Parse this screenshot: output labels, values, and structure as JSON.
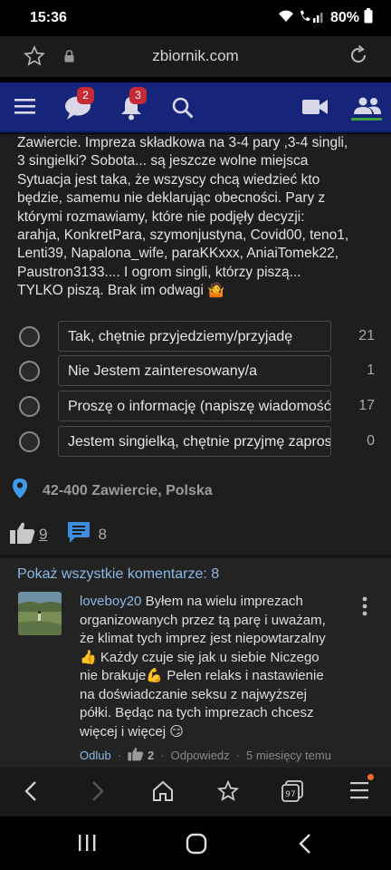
{
  "status_bar": {
    "time": "15:36",
    "battery": "80%"
  },
  "browser": {
    "url": "zbiornik.com"
  },
  "nav": {
    "messages_badge": "2",
    "notifications_badge": "3"
  },
  "post": {
    "text": "Zawiercie. Impreza składkowa na 3-4 pary ,3-4 singli,\n3 singielki? Sobota... są jeszcze wolne miejsca\nSytuacja jest taka, że wszyscy chcą wiedzieć kto\nbędzie, samemu nie deklarując obecności. Pary z\nktórymi rozmawiamy, które nie podjęły decyzji:\narahja, KonkretPara, szymonjustyna, Covid00, teno1,\nLenti39, Napalona_wife, paraKKxxx, AniaiTomek22,\nPaustron3133.... I ogrom singli, którzy piszą...\nTYLKO piszą. Brak im odwagi 🤷"
  },
  "poll": {
    "options": [
      {
        "label": "Tak, chętnie przyjedziemy/przyjadę",
        "count": "21"
      },
      {
        "label": "Nie Jestem zainteresowany/a",
        "count": "1"
      },
      {
        "label": "Proszę o informację (napiszę wiadomość)",
        "count": "17"
      },
      {
        "label": "Jestem singielką, chętnie przyjmę zaproszenie",
        "count": "0"
      }
    ]
  },
  "location": {
    "text": "42-400 Zawiercie, Polska"
  },
  "reactions": {
    "likes": "9",
    "comments": "8"
  },
  "comments": {
    "show_all": "Pokaż wszystkie komentarze: 8",
    "first": {
      "author": "loveboy20",
      "text": "Byłem na wielu imprezach\norganizowanych przez tą parę i uważam,\nże klimat tych imprez jest niepowtarzalny\n👍 Każdy czuje się jak u siebie Niczego\nnie brakuje💪 Pełen relaks i nastawienie\nna doświadczanie seksu z najwyższej\npółki. Będąc na tych imprezach chcesz\nwięcej i więcej 😏",
      "reply_link": "Odlub",
      "likes": "2",
      "reply": "Odpowiedz",
      "time": "5 miesięcy temu"
    }
  },
  "browser_toolbar": {
    "tabs_count": "97"
  },
  "colors": {
    "nav_background": "#16257a",
    "badge": "#c52a35",
    "link": "#8cb8e6",
    "location_pin": "#3d9be9",
    "active_underline": "#3ea03e"
  }
}
